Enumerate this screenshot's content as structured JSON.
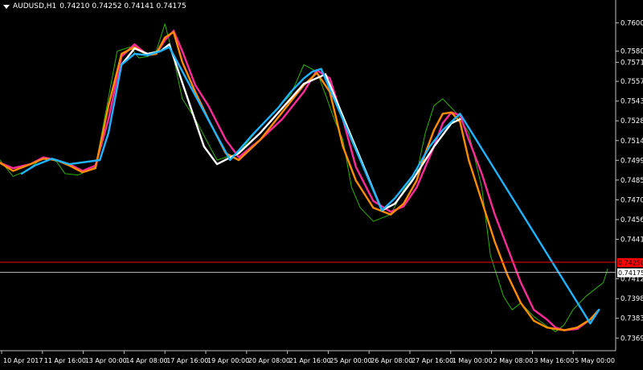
{
  "header": {
    "symbol": "AUDUSD,H1",
    "ohlc": "0.74210 0.74252 0.74141 0.74175"
  },
  "chart_data": {
    "type": "line",
    "title": "AUDUSD,H1",
    "ylim": [
      0.736,
      0.7614
    ],
    "y_ticks": [
      "0.76008",
      "0.75800",
      "0.75718",
      "0.75578",
      "0.75433",
      "0.75288",
      "0.75143",
      "0.74998",
      "0.74853",
      "0.74708",
      "0.74563",
      "0.74418",
      "0.74128",
      "0.73983",
      "0.73838",
      "0.73693"
    ],
    "x_ticks": [
      "10 Apr 2017",
      "11 Apr 16:00",
      "13 Apr 00:00",
      "14 Apr 08:00",
      "17 Apr 16:00",
      "19 Apr 00:00",
      "20 Apr 08:00",
      "21 Apr 16:00",
      "25 Apr 00:00",
      "26 Apr 08:00",
      "27 Apr 16:00",
      "1 May 00:00",
      "2 May 08:00",
      "3 May 16:00",
      "5 May 00:00"
    ],
    "price_levels": [
      {
        "label": "0.74250",
        "value": 0.7425,
        "color": "#ff0000"
      },
      {
        "label": "0.74175",
        "value": 0.74175,
        "color": "#c0c0c0"
      }
    ],
    "series": [
      {
        "color": "#2db300",
        "x": [
          0,
          3,
          6,
          10,
          13,
          15,
          18,
          22,
          27,
          30,
          32,
          34,
          36,
          38,
          40,
          42,
          45,
          50,
          55,
          60,
          63,
          67,
          70,
          73,
          75,
          77,
          79,
          81,
          83,
          86,
          90,
          93,
          96,
          98,
          100,
          102,
          105,
          108,
          111,
          113,
          116,
          118,
          120,
          123,
          126,
          128,
          130,
          132,
          135,
          137,
          139,
          140
        ],
        "values": [
          0.75,
          0.7488,
          0.7492,
          0.7502,
          0.7499,
          0.749,
          0.7489,
          0.7495,
          0.758,
          0.7583,
          0.7575,
          0.7576,
          0.758,
          0.76,
          0.7575,
          0.7545,
          0.753,
          0.75,
          0.7505,
          0.7525,
          0.7535,
          0.7548,
          0.757,
          0.7565,
          0.7548,
          0.753,
          0.7515,
          0.748,
          0.7465,
          0.7455,
          0.746,
          0.7478,
          0.749,
          0.752,
          0.754,
          0.7545,
          0.7535,
          0.752,
          0.748,
          0.743,
          0.74,
          0.739,
          0.7395,
          0.7385,
          0.7378,
          0.7374,
          0.7379,
          0.739,
          0.74,
          0.7405,
          0.741,
          0.742
        ]
      },
      {
        "color": "#ff2a9a",
        "x": [
          0,
          3,
          7,
          10,
          13,
          16,
          19,
          22,
          25,
          28,
          31,
          34,
          36,
          38,
          40,
          42,
          45,
          48,
          52,
          55,
          60,
          65,
          70,
          73,
          76,
          79,
          82,
          86,
          90,
          93,
          96,
          98,
          100,
          102,
          104,
          106,
          108,
          111,
          114,
          117,
          120,
          123,
          126,
          128,
          130,
          133,
          136,
          138
        ],
        "values": [
          0.7498,
          0.7494,
          0.7497,
          0.7502,
          0.75,
          0.7497,
          0.7492,
          0.7496,
          0.753,
          0.7576,
          0.7585,
          0.7577,
          0.7578,
          0.7588,
          0.7595,
          0.758,
          0.7555,
          0.754,
          0.7515,
          0.7502,
          0.7515,
          0.753,
          0.755,
          0.7566,
          0.756,
          0.753,
          0.7495,
          0.747,
          0.7462,
          0.7466,
          0.748,
          0.7495,
          0.751,
          0.7527,
          0.7535,
          0.7533,
          0.7515,
          0.749,
          0.746,
          0.7435,
          0.741,
          0.739,
          0.7383,
          0.7377,
          0.7375,
          0.7376,
          0.7383,
          0.739
        ]
      },
      {
        "color": "#ff8c00",
        "x": [
          0,
          3,
          7,
          10,
          13,
          16,
          19,
          22,
          25,
          28,
          31,
          34,
          36,
          38,
          40,
          42,
          45,
          48,
          52,
          55,
          60,
          65,
          70,
          73,
          76,
          79,
          82,
          86,
          90,
          93,
          96,
          98,
          100,
          102,
          104,
          106,
          108,
          111,
          114,
          117,
          120,
          123,
          126,
          128,
          130,
          133,
          136,
          138
        ],
        "values": [
          0.7498,
          0.7492,
          0.7497,
          0.7501,
          0.75,
          0.7496,
          0.7491,
          0.7494,
          0.754,
          0.7578,
          0.7583,
          0.7577,
          0.7578,
          0.759,
          0.7594,
          0.7572,
          0.755,
          0.753,
          0.7505,
          0.75,
          0.7515,
          0.7535,
          0.7555,
          0.7564,
          0.755,
          0.751,
          0.7485,
          0.7465,
          0.746,
          0.7468,
          0.7485,
          0.7505,
          0.7522,
          0.7534,
          0.7535,
          0.7528,
          0.75,
          0.747,
          0.744,
          0.7415,
          0.7395,
          0.7382,
          0.7377,
          0.7376,
          0.7375,
          0.7377,
          0.7383,
          0.739
        ]
      },
      {
        "color": "#ffffff",
        "x": [
          28,
          31,
          34,
          37,
          39,
          47,
          50,
          55,
          60,
          65,
          70,
          75,
          88,
          91,
          95,
          100,
          104,
          106
        ],
        "values": [
          0.757,
          0.7582,
          0.7578,
          0.758,
          0.7585,
          0.751,
          0.7497,
          0.7505,
          0.752,
          0.7538,
          0.7556,
          0.7563,
          0.7463,
          0.7468,
          0.7485,
          0.751,
          0.7527,
          0.753
        ]
      },
      {
        "color": "#1eb4ff",
        "x": [
          5,
          8,
          12,
          16,
          23,
          25,
          28,
          31,
          34,
          37,
          39,
          53,
          55,
          58,
          61,
          64,
          67,
          70,
          72,
          74,
          88,
          91,
          95,
          99,
          102,
          106,
          136,
          138
        ],
        "values": [
          0.749,
          0.7496,
          0.7501,
          0.7497,
          0.75,
          0.752,
          0.757,
          0.7578,
          0.7577,
          0.758,
          0.7583,
          0.75,
          0.7507,
          0.7518,
          0.7528,
          0.7538,
          0.755,
          0.756,
          0.7565,
          0.7567,
          0.7463,
          0.7472,
          0.7488,
          0.751,
          0.7522,
          0.7534,
          0.738,
          0.739
        ]
      }
    ],
    "grid": false,
    "legend": "none"
  }
}
